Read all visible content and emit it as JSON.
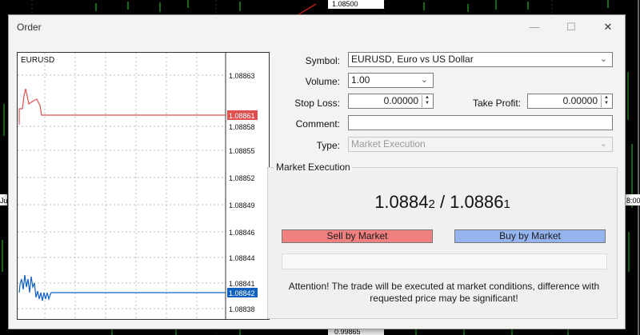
{
  "background": {
    "top_price_label": "1.08500",
    "bottom_price_label": "0.99865",
    "left_edge_label": "Ju",
    "right_edge_label": "8:00"
  },
  "window": {
    "title": "Order",
    "minimize_glyph": "—",
    "maximize_glyph": "☐",
    "close_glyph": "✕"
  },
  "mini_chart": {
    "symbol": "EURUSD",
    "price_labels": [
      "1.08863",
      "1.08858",
      "1.08855",
      "1.08852",
      "1.08849",
      "1.08846",
      "1.08844",
      "1.08841",
      "1.08838"
    ],
    "ask_label": "1.08861",
    "bid_label": "1.08842",
    "ask_color": "#e05050",
    "bid_color": "#1060c0"
  },
  "form": {
    "symbol_label": "Symbol:",
    "symbol_value": "EURUSD, Euro vs US Dollar",
    "volume_label": "Volume:",
    "volume_value": "1.00",
    "stop_loss_label": "Stop Loss:",
    "stop_loss_value": "0.00000",
    "take_profit_label": "Take Profit:",
    "take_profit_value": "0.00000",
    "comment_label": "Comment:",
    "comment_value": "",
    "type_label": "Type:",
    "type_value": "Market Execution"
  },
  "execution": {
    "group_title": "Market Execution",
    "bid_main": "1.0884",
    "bid_small": "2",
    "separator": " / ",
    "ask_main": "1.0886",
    "ask_small": "1",
    "sell_label": "Sell by Market",
    "buy_label": "Buy by Market",
    "sell_color": "#f08080",
    "buy_color": "#94b4f0",
    "attention_line1": "Attention! The trade will be executed at market conditions, difference with",
    "attention_line2": "requested price may be significant!"
  }
}
